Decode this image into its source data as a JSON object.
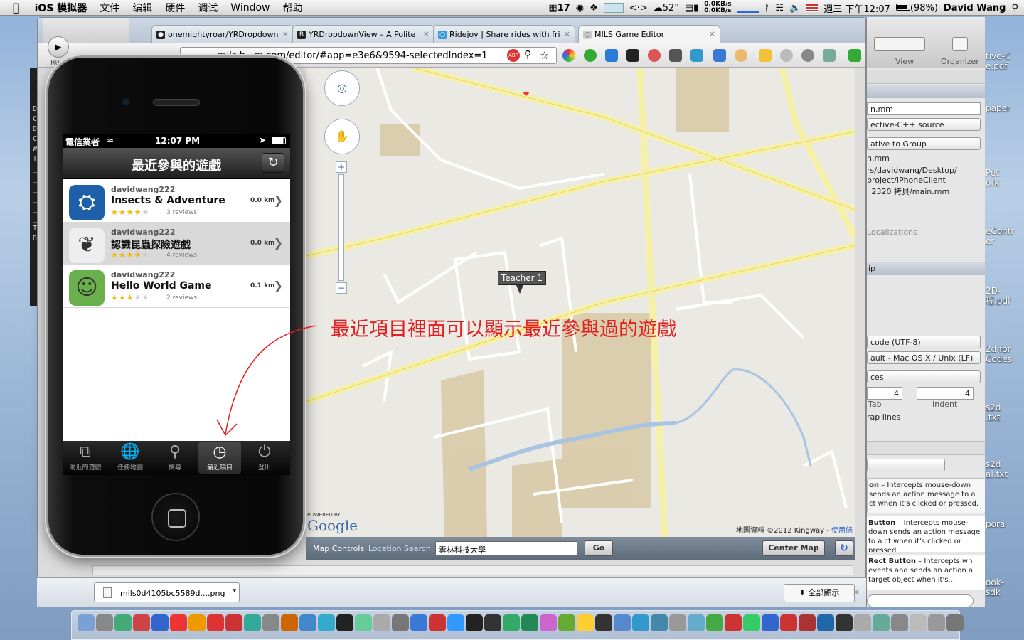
{
  "menubar": {
    "app": "iOS 模拟器",
    "items": [
      "文件",
      "编辑",
      "硬件",
      "调试",
      "Window",
      "帮助"
    ],
    "status": {
      "cal": "17",
      "temp": "52°",
      "net_up": "0.0KB/s",
      "net_down": "0.0KB/s",
      "clock": "週三 下午12:07",
      "battery": "(98%)",
      "user": "David Wang"
    }
  },
  "browser": {
    "tabs": [
      {
        "title": "onemightyroar/YRDropdown"
      },
      {
        "title": "YRDropdownView – A Polite"
      },
      {
        "title": "Ridejoy | Share rides with fri"
      },
      {
        "title": "MILS Game Editor"
      }
    ],
    "url": "mils.b...m.com/editor/#app=e3e6&9594-selectedIndex=1",
    "toolbar_labels": {
      "run": "Ru"
    },
    "download": {
      "file": "mils0d4105bc5589d....png",
      "show_all": "全部顯示"
    }
  },
  "map": {
    "marker": "Teacher 1",
    "annotation": "最近項目裡面可以顯示最近參與過的遊戲",
    "attribution": "地圖資料 ©2012 Kingway - ",
    "terms": "使用條",
    "powered_by": "POWERED BY",
    "google": "Google",
    "controls": {
      "label": "Map Controls",
      "search_label": "Location Search:",
      "search_value": "雲林科技大學",
      "go": "Go",
      "center": "Center Map"
    }
  },
  "iphone": {
    "carrier": "電信業者",
    "time": "12:07 PM",
    "title": "最近參與的遊戲",
    "games": [
      {
        "owner": "davidwang222",
        "name": "Insects & Adventure",
        "stars": 4,
        "reviews": "3 reviews",
        "distance": "0.0 km"
      },
      {
        "owner": "davidwang222",
        "name": "認識昆蟲探險遊戲",
        "stars": 4,
        "reviews": "4 reviews",
        "distance": "0.0 km"
      },
      {
        "owner": "davidwang222",
        "name": "Hello World Game",
        "stars": 3,
        "reviews": "2 reviews",
        "distance": "0.1 km"
      }
    ],
    "tabs": [
      {
        "label": "附近的遊戲",
        "icon": "nearby-icon"
      },
      {
        "label": "任務地圖",
        "icon": "globe-icon"
      },
      {
        "label": "搜尋",
        "icon": "search-icon"
      },
      {
        "label": "最近項目",
        "icon": "clock-icon"
      },
      {
        "label": "登出",
        "icon": "power-icon"
      }
    ],
    "selected_tab": 3
  },
  "inspector": {
    "toolbar": [
      "View",
      "Organizer"
    ],
    "filename": "n.mm",
    "filetype": "ective-C++ source",
    "location": "ative to Group",
    "fullpath_name": "n.mm",
    "fullpath": [
      "rs/davidwang/Desktop/",
      "project/iPhoneClient",
      "l 2320 拷貝/main.mm"
    ],
    "localizations": "Localizations",
    "section": "ip",
    "encoding": "code (UTF-8)",
    "line_endings": "ault - Mac OS X / Unix (LF)",
    "indent_using": "ces",
    "tab_value": "4",
    "indent_value": "4",
    "tab_label": "Tab",
    "indent_label": "Indent",
    "wrap": "rap lines",
    "library": [
      {
        "title": "on",
        "desc": " – Intercepts mouse-down sends an action message to a ct when it's clicked or pressed."
      },
      {
        "title": "Button",
        "desc": " – Intercepts mouse-down sends an action message to a ct when it's clicked or pressed."
      },
      {
        "title": "Rect Button",
        "desc": " – Intercepts wn events and sends an action a target object when it's..."
      }
    ]
  },
  "desktop": {
    "icons": [
      "tive-C\ne.pdf",
      "paper",
      "Pet\nork",
      "eContr\ner",
      "2D-\n程.pdf",
      "2d for\nCodes",
      "s2d\n.txt",
      "s2d\nal.txt",
      "pora",
      "ook-\nsdk"
    ]
  },
  "terminal": [
    "D",
    "C",
    "D",
    "C",
    "W",
    "T",
    "_",
    "_",
    "_",
    "_",
    "_",
    "_",
    "T",
    "D"
  ]
}
